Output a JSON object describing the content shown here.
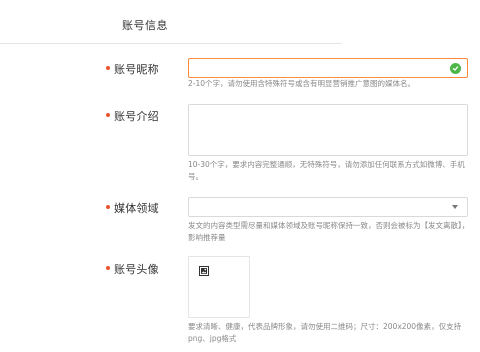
{
  "header": {
    "title": "账号信息"
  },
  "colors": {
    "required_dot": "#e8542e",
    "focus_border": "#ff8a3d",
    "valid_check": "#4cb648",
    "hint_text": "#888888"
  },
  "form": {
    "nickname": {
      "label": "账号昵称",
      "value": "",
      "status_icon": "check-circle-icon",
      "hint": "2-10个字，请勿使用含特殊符号或含有明显营销推广意图的媒体名。"
    },
    "intro": {
      "label": "账号介绍",
      "value": "",
      "hint": "10-30个字，要求内容完整通顺，无特殊符号，请勿添加任何联系方式如微博、手机号。"
    },
    "media_field": {
      "label": "媒体领域",
      "selected": "",
      "caret_icon": "caret-down-icon",
      "hint": "发文的内容类型需尽量和媒体领域及账号昵称保持一致，否则会被标为【发文离散】，影响推荐量"
    },
    "avatar": {
      "label": "账号头像",
      "upload_icon": "image-upload-icon",
      "hint": "要求清晰、健康，代表品牌形象，请勿使用二维码；尺寸：200x200像素，仅支持png、jpg格式"
    }
  }
}
